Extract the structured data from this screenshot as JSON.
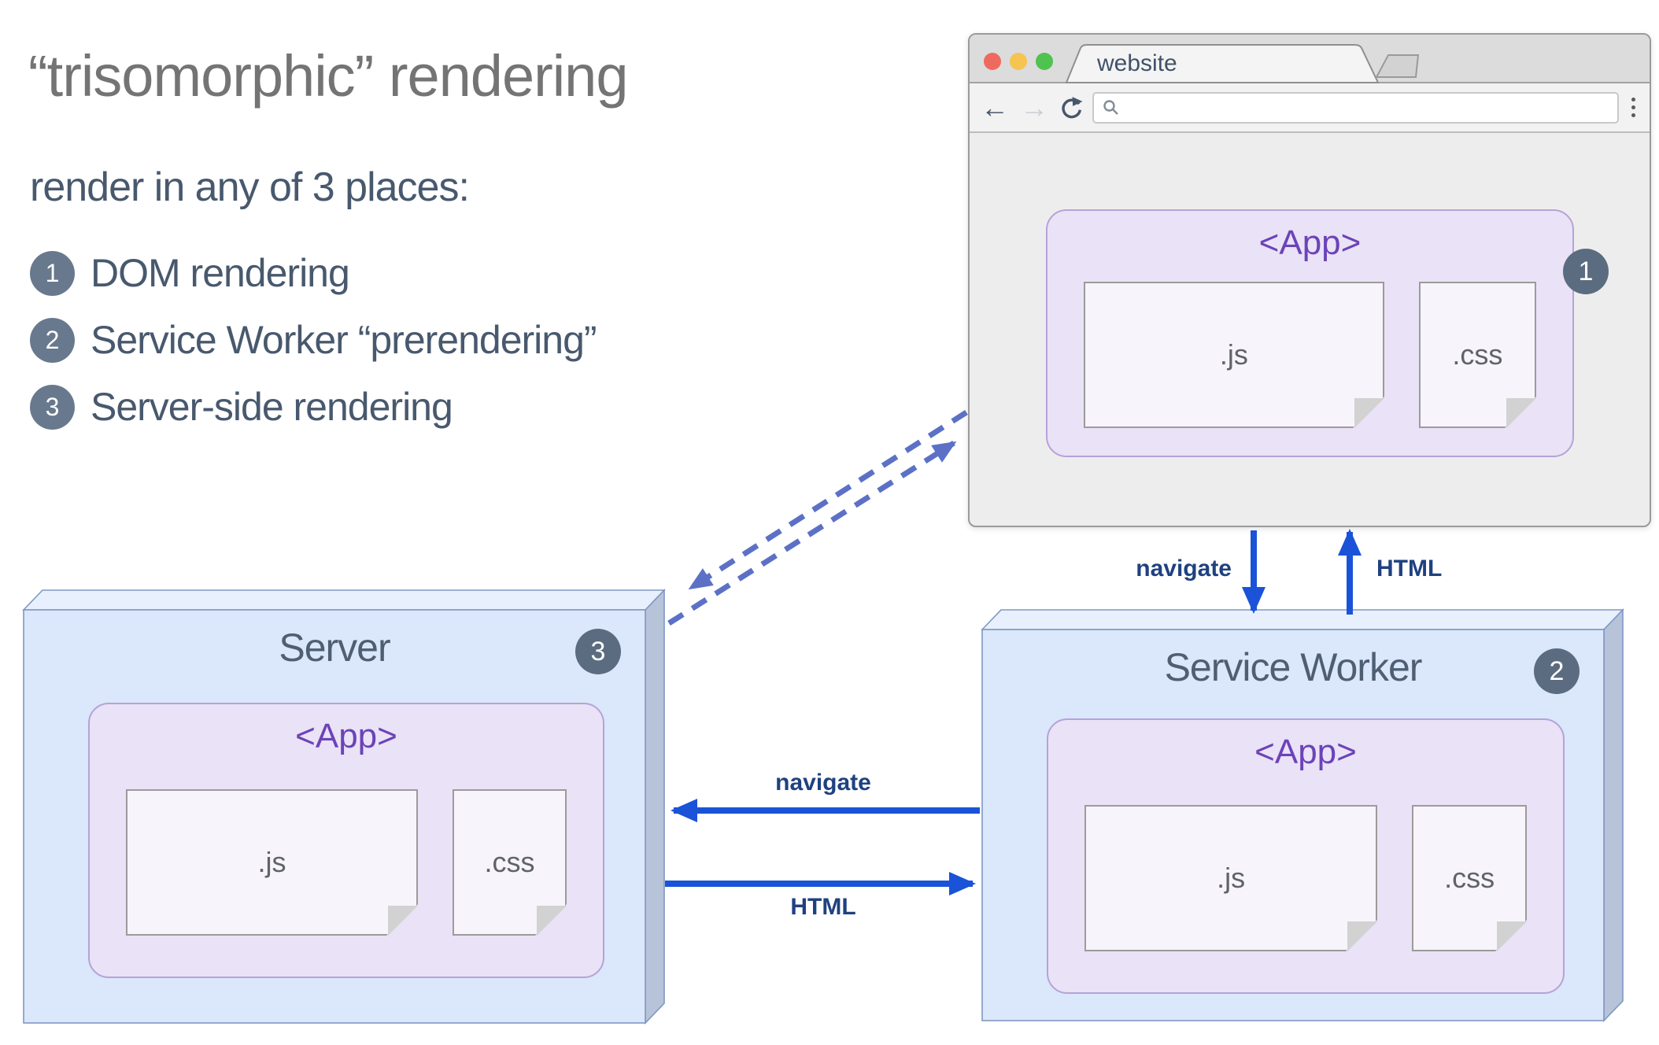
{
  "intro": {
    "title": "“trisomorphic” rendering",
    "subtitle": "render in any of 3 places:",
    "items": [
      {
        "num": "1",
        "label": "DOM rendering"
      },
      {
        "num": "2",
        "label": "Service Worker “prerendering”"
      },
      {
        "num": "3",
        "label": "Server-side rendering"
      }
    ]
  },
  "browser": {
    "tab_title": "website",
    "url_value": "",
    "badge": "1",
    "traffic_lights": [
      "#ee6a5f",
      "#f5c451",
      "#4fc24f"
    ],
    "icons": {
      "back_glyph": "←",
      "forward_glyph": "→",
      "reload": "reload-icon",
      "search": "magnifier-icon",
      "menu": "kebab-menu-icon"
    },
    "app": {
      "label": "<App>",
      "js": ".js",
      "css": ".css"
    }
  },
  "server": {
    "title": "Server",
    "badge": "3",
    "app": {
      "label": "<App>",
      "js": ".js",
      "css": ".css"
    }
  },
  "service_worker": {
    "title": "Service Worker",
    "badge": "2",
    "app": {
      "label": "<App>",
      "js": ".js",
      "css": ".css"
    }
  },
  "flows": {
    "navigate_down": "navigate",
    "html_up": "HTML",
    "navigate_left": "navigate",
    "html_right": "HTML"
  },
  "colors": {
    "solid_arrow_blue": "#1a53d8",
    "dashed_arrow_blue": "#5c71c6",
    "flow_label_navy": "#1f4180",
    "box_front_blue": "#dbe7fa",
    "box_top_blue": "#e9f0fd",
    "box_side_blue": "#b7c3d9",
    "box_border_blue": "#7f98c4",
    "app_purple_bg": "#eae2f6",
    "app_purple_border": "#b5a3d8",
    "app_text_purple": "#6b43b8",
    "badge_slate": "#5b6c80",
    "list_circle_slate": "#68798e",
    "body_text_slate": "#48596e",
    "title_gray": "#747474"
  }
}
